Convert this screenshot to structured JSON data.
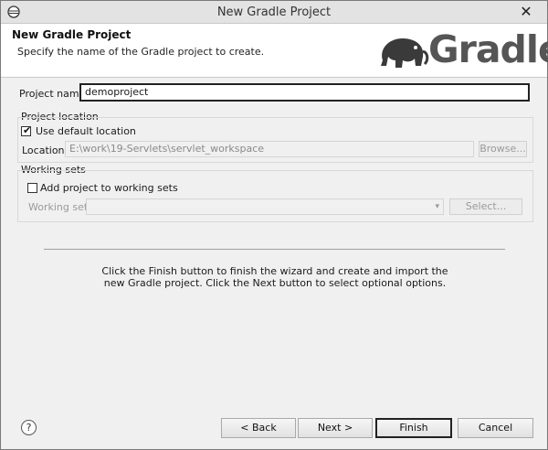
{
  "window": {
    "title": "New Gradle Project",
    "close_glyph": "✕"
  },
  "banner": {
    "title": "New Gradle Project",
    "description": "Specify the name of the Gradle project to create.",
    "logo_text": "Gradle"
  },
  "project_name": {
    "label": "Project name",
    "value": "demoproject"
  },
  "location_group": {
    "title": "Project location",
    "use_default_label": "Use default location",
    "use_default_checked": true,
    "location_label": "Location",
    "location_value": "E:\\work\\19-Servlets\\servlet_workspace",
    "browse_label": "Browse..."
  },
  "working_sets": {
    "title": "Working sets",
    "add_label": "Add project to working sets",
    "add_checked": false,
    "sets_label": "Working sets",
    "sets_value": "",
    "select_label": "Select..."
  },
  "info_text": "Click the Finish button to finish the wizard and create and import the new Gradle project. Click the Next button to select optional options.",
  "buttons": {
    "help": "?",
    "back": "< Back",
    "next": "Next >",
    "finish": "Finish",
    "cancel": "Cancel"
  }
}
